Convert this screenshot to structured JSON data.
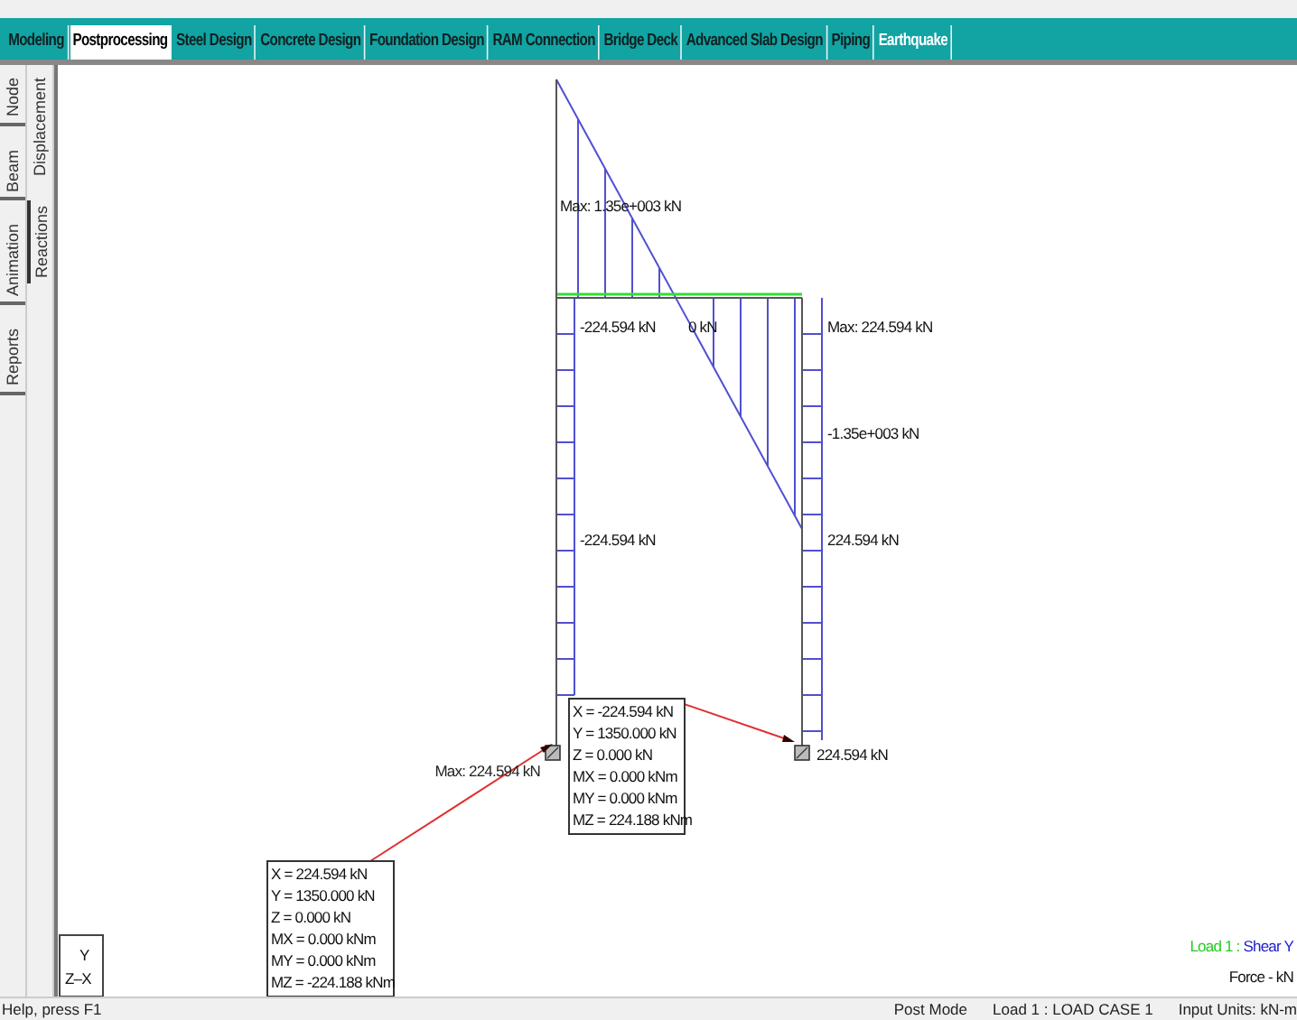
{
  "top_tabs": [
    {
      "label": "Modeling",
      "selected": false,
      "highlighted": false
    },
    {
      "label": "Postprocessing",
      "selected": true,
      "highlighted": false
    },
    {
      "label": "Steel Design",
      "selected": false,
      "highlighted": false
    },
    {
      "label": "Concrete Design",
      "selected": false,
      "highlighted": false
    },
    {
      "label": "Foundation Design",
      "selected": false,
      "highlighted": false
    },
    {
      "label": "RAM Connection",
      "selected": false,
      "highlighted": false
    },
    {
      "label": "Bridge Deck",
      "selected": false,
      "highlighted": false
    },
    {
      "label": "Advanced Slab Design",
      "selected": false,
      "highlighted": false
    },
    {
      "label": "Piping",
      "selected": false,
      "highlighted": false
    },
    {
      "label": "Earthquake",
      "selected": false,
      "highlighted": true
    }
  ],
  "side_tabs": {
    "outer": [
      {
        "label": "Node"
      },
      {
        "label": "Beam"
      },
      {
        "label": "Animation"
      },
      {
        "label": "Reports"
      }
    ],
    "inner": [
      {
        "label": "Displacement",
        "selected": false
      },
      {
        "label": "Reactions",
        "selected": true
      }
    ]
  },
  "diagram": {
    "labels": [
      {
        "text": "Max: 1.35e+003 kN"
      },
      {
        "text": "-224.594 kN"
      },
      {
        "text": "0 kN"
      },
      {
        "text": "Max: 224.594 kN"
      },
      {
        "text": "-1.35e+003 kN"
      },
      {
        "text": "-224.594 kN"
      },
      {
        "text": "224.594 kN"
      }
    ],
    "overlap_label": "Max: 224.594 kN",
    "support_label": "224.594 kN",
    "tooltips": [
      {
        "lines": [
          "X = -224.594 kN",
          "Y = 1350.000 kN",
          "Z = 0.000 kN",
          "MX = 0.000 kNm",
          "MY = 0.000 kNm",
          "MZ = 224.188 kNm"
        ]
      },
      {
        "lines": [
          "X = 224.594 kN",
          "Y = 1350.000 kN",
          "Z = 0.000 kN",
          "MX = 0.000 kNm",
          "MY = 0.000 kNm",
          "MZ = -224.188 kNm"
        ]
      }
    ]
  },
  "axis": {
    "up": "Y",
    "across": "Z–X"
  },
  "legend": {
    "load": "Load 1",
    "separator": " : ",
    "quantity": "Shear Y",
    "units": "Force - kN"
  },
  "status_bar": {
    "help": "Help, press F1",
    "mode": "Post Mode",
    "load": "Load 1 : LOAD CASE 1",
    "units": "Input Units:  kN-m"
  }
}
